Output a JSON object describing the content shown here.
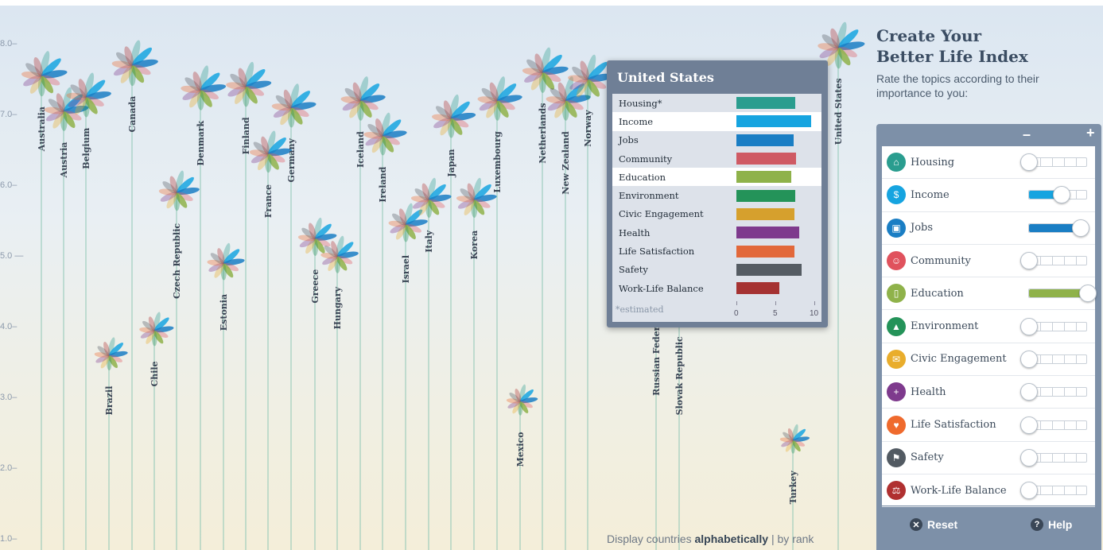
{
  "sidebar": {
    "title_line1": "Create Your",
    "title_line2": "Better Life Index",
    "subtitle": "Rate the topics according to their importance to you:",
    "minus_label": "–",
    "plus_label": "+",
    "topics": [
      {
        "label": "Housing",
        "color": "#2a9d8f",
        "rating": 0.0,
        "icon": "house-icon",
        "glyph": "⌂"
      },
      {
        "label": "Income",
        "color": "#16a4e0",
        "rating": 0.55,
        "icon": "money-icon",
        "glyph": "$"
      },
      {
        "label": "Jobs",
        "color": "#1a7ec4",
        "rating": 0.88,
        "icon": "briefcase-icon",
        "glyph": "▣"
      },
      {
        "label": "Community",
        "color": "#e0525d",
        "rating": 0.0,
        "icon": "people-icon",
        "glyph": "☺"
      },
      {
        "label": "Education",
        "color": "#8fb24a",
        "rating": 1.0,
        "icon": "book-icon",
        "glyph": "▯"
      },
      {
        "label": "Environment",
        "color": "#249359",
        "rating": 0.0,
        "icon": "tree-icon",
        "glyph": "▲"
      },
      {
        "label": "Civic Engagement",
        "color": "#e9ad2c",
        "rating": 0.0,
        "icon": "envelope-icon",
        "glyph": "✉"
      },
      {
        "label": "Health",
        "color": "#7e3a8d",
        "rating": 0.0,
        "icon": "cross-icon",
        "glyph": "+"
      },
      {
        "label": "Life Satisfaction",
        "color": "#ef6a2d",
        "rating": 0.0,
        "icon": "heart-icon",
        "glyph": "♥"
      },
      {
        "label": "Safety",
        "color": "#525a62",
        "rating": 0.0,
        "icon": "runner-icon",
        "glyph": "⚑"
      },
      {
        "label": "Work-Life Balance",
        "color": "#b03030",
        "rating": 0.0,
        "icon": "scale-icon",
        "glyph": "⚖"
      }
    ],
    "reset_label": "Reset",
    "help_label": "Help"
  },
  "tooltip": {
    "country": "United States",
    "note": "*estimated",
    "axis_ticks": [
      "0",
      "5",
      "10"
    ],
    "rows": [
      {
        "label": "Housing*",
        "value": 7.6,
        "color": "#2a9d8f"
      },
      {
        "label": "Income",
        "value": 9.6,
        "color": "#16a4e0"
      },
      {
        "label": "Jobs",
        "value": 7.3,
        "color": "#1a7ec4"
      },
      {
        "label": "Community",
        "value": 7.7,
        "color": "#cf5a64"
      },
      {
        "label": "Education",
        "value": 7.0,
        "color": "#8fb24a"
      },
      {
        "label": "Environment",
        "value": 7.6,
        "color": "#249359"
      },
      {
        "label": "Civic Engagement",
        "value": 7.4,
        "color": "#d6a02d"
      },
      {
        "label": "Health",
        "value": 8.1,
        "color": "#7e3a8d"
      },
      {
        "label": "Life Satisfaction",
        "value": 7.4,
        "color": "#e2683a"
      },
      {
        "label": "Safety",
        "value": 8.4,
        "color": "#555c63"
      },
      {
        "label": "Work-Life Balance",
        "value": 5.5,
        "color": "#a53232"
      }
    ]
  },
  "display_prefix": "Display countries ",
  "display_alpha": "alphabetically",
  "display_sep": " | ",
  "display_rank": "by rank",
  "y_axis": [
    "8.0–",
    "7.0–",
    "6.0–",
    "5.0 —",
    "4.0–",
    "3.0–",
    "2.0–",
    "1.0–"
  ],
  "countries": [
    {
      "name": "Australia",
      "score": 7.55
    },
    {
      "name": "Austria",
      "score": 7.05
    },
    {
      "name": "Belgium",
      "score": 7.25
    },
    {
      "name": "Canada",
      "score": 7.7
    },
    {
      "name": "Chile",
      "score": 3.95
    },
    {
      "name": "Brazil",
      "score": 3.6
    },
    {
      "name": "Czech Republic",
      "score": 5.9
    },
    {
      "name": "Denmark",
      "score": 7.35
    },
    {
      "name": "Estonia",
      "score": 4.9
    },
    {
      "name": "Finland",
      "score": 7.4
    },
    {
      "name": "France",
      "score": 6.45
    },
    {
      "name": "Germany",
      "score": 7.1
    },
    {
      "name": "Greece",
      "score": 5.25
    },
    {
      "name": "Hungary",
      "score": 5.0
    },
    {
      "name": "Iceland",
      "score": 7.2
    },
    {
      "name": "Ireland",
      "score": 6.7
    },
    {
      "name": "Israel",
      "score": 5.45
    },
    {
      "name": "Italy",
      "score": 5.8
    },
    {
      "name": "Japan",
      "score": 6.95
    },
    {
      "name": "Korea",
      "score": 5.8
    },
    {
      "name": "Luxembourg",
      "score": 7.2
    },
    {
      "name": "Mexico",
      "score": 2.95
    },
    {
      "name": "Netherlands",
      "score": 7.6
    },
    {
      "name": "New Zealand",
      "score": 7.2
    },
    {
      "name": "Norway",
      "score": 7.5
    },
    {
      "name": "Russian Federation",
      "score": 4.8
    },
    {
      "name": "Slovak Republic",
      "score": 4.3
    },
    {
      "name": "Turkey",
      "score": 2.4
    },
    {
      "name": "United States",
      "score": 7.95
    }
  ]
}
